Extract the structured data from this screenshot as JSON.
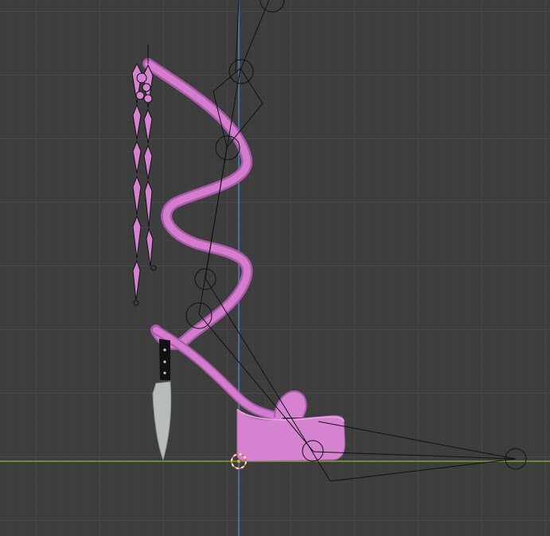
{
  "viewport": {
    "background_color": "#3d3d3d",
    "grid_major_color": "#474747",
    "grid_minor_color": "#424242",
    "x_axis_color": "#7aa33a",
    "z_axis_color": "#4a7ec9"
  },
  "objects": {
    "strap_color": "#d47dcf",
    "strap_shadow_color": "#a85aa8",
    "sole_color": "#d583d0",
    "armature_color": "#111111",
    "knife_blade_color": "#b8bcbc",
    "knife_handle_color": "#111111",
    "cursor_color": "#e06a3a"
  },
  "icons": {
    "cursor": "3d-cursor-icon",
    "armature": "armature-bones-icon"
  }
}
